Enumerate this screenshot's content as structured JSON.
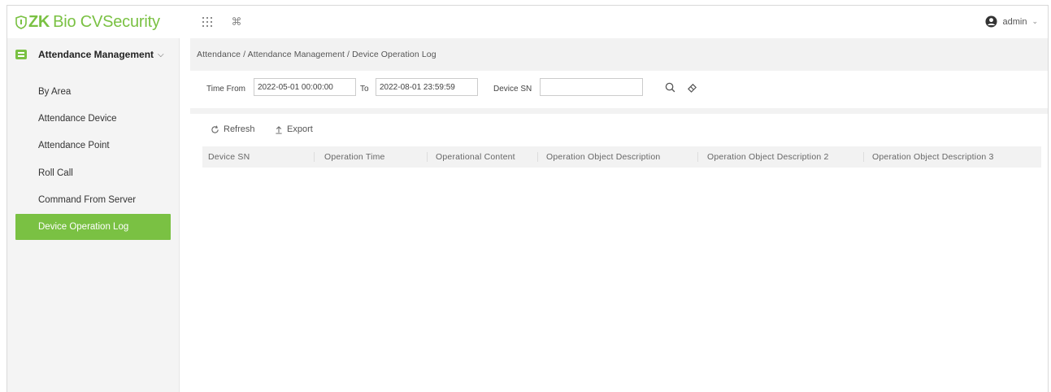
{
  "app": {
    "logo_prefix": "ZK",
    "logo_rest": "Bio CVSecurity",
    "brand_color": "#7ac143"
  },
  "topbar": {
    "icons": [
      "grid-icon",
      "command-icon"
    ],
    "user_name": "admin"
  },
  "sidebar": {
    "module_label": "Attendance Management",
    "items": [
      {
        "label": "By Area",
        "active": false
      },
      {
        "label": "Attendance Device",
        "active": false
      },
      {
        "label": "Attendance Point",
        "active": false
      },
      {
        "label": "Roll Call",
        "active": false
      },
      {
        "label": "Command From Server",
        "active": false
      },
      {
        "label": "Device Operation Log",
        "active": true
      }
    ]
  },
  "breadcrumb": "Attendance / Attendance Management / Device Operation Log",
  "filter": {
    "time_from_label": "Time From",
    "time_from_value": "2022-05-01 00:00:00",
    "to_label": "To",
    "to_value": "2022-08-01 23:59:59",
    "device_sn_label": "Device SN",
    "device_sn_value": ""
  },
  "toolbar": {
    "refresh_label": "Refresh",
    "export_label": "Export"
  },
  "table": {
    "columns": [
      "Device SN",
      "Operation Time",
      "Operational Content",
      "Operation Object Description",
      "Operation Object Description 2",
      "Operation Object Description 3"
    ],
    "rows": []
  }
}
